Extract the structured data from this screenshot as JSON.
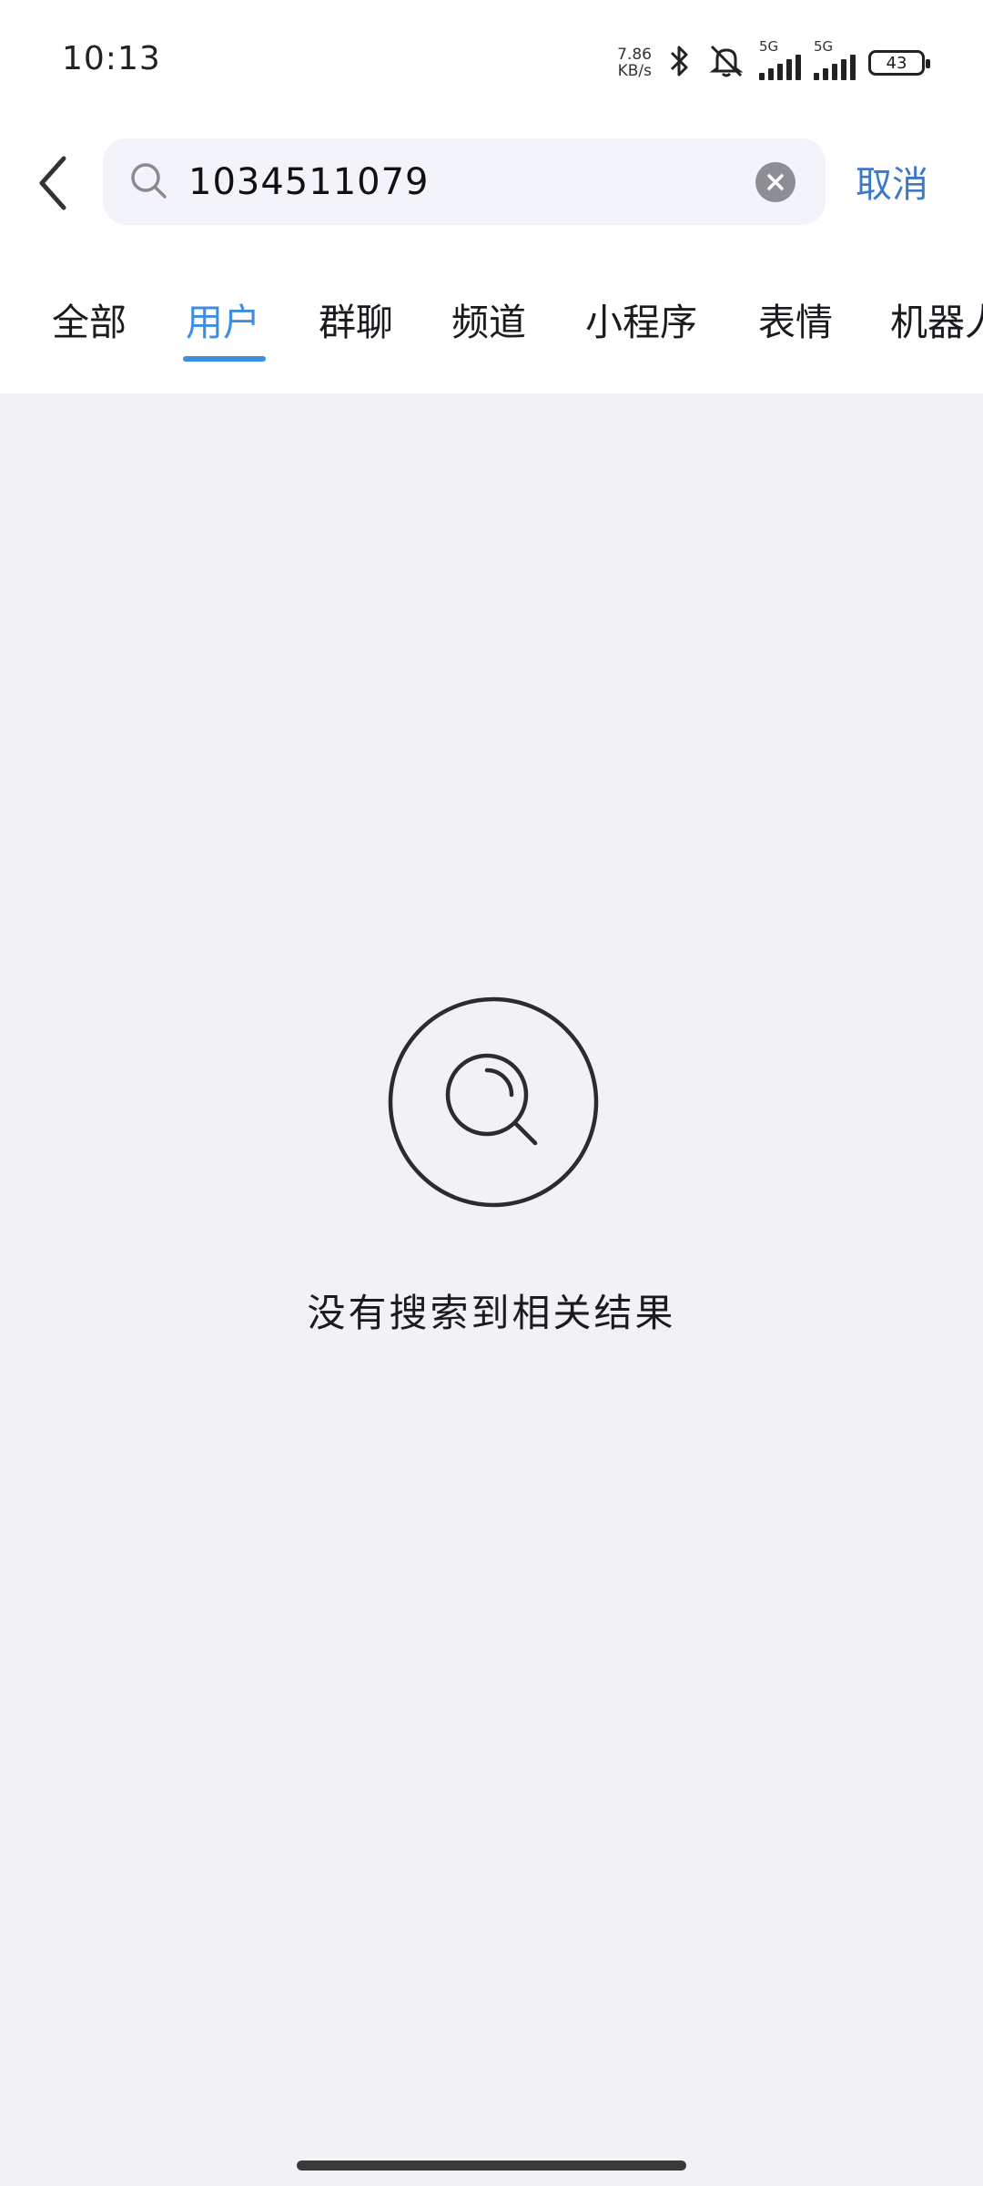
{
  "status_bar": {
    "time": "10:13",
    "net_speed_value": "7.86",
    "net_speed_unit": "KB/s",
    "sim1_label": "5G",
    "sim2_label": "5G",
    "battery": "43"
  },
  "search": {
    "query": "1034511079",
    "cancel_label": "取消"
  },
  "tabs": [
    {
      "label": "全部"
    },
    {
      "label": "用户"
    },
    {
      "label": "群聊"
    },
    {
      "label": "频道"
    },
    {
      "label": "小程序"
    },
    {
      "label": "表情"
    },
    {
      "label": "机器人"
    }
  ],
  "active_tab": "用户",
  "empty_state": {
    "message": "没有搜索到相关结果"
  },
  "colors": {
    "accent": "#3e8ee0",
    "cancel": "#3d79c7",
    "background": "#f1f1f6"
  }
}
